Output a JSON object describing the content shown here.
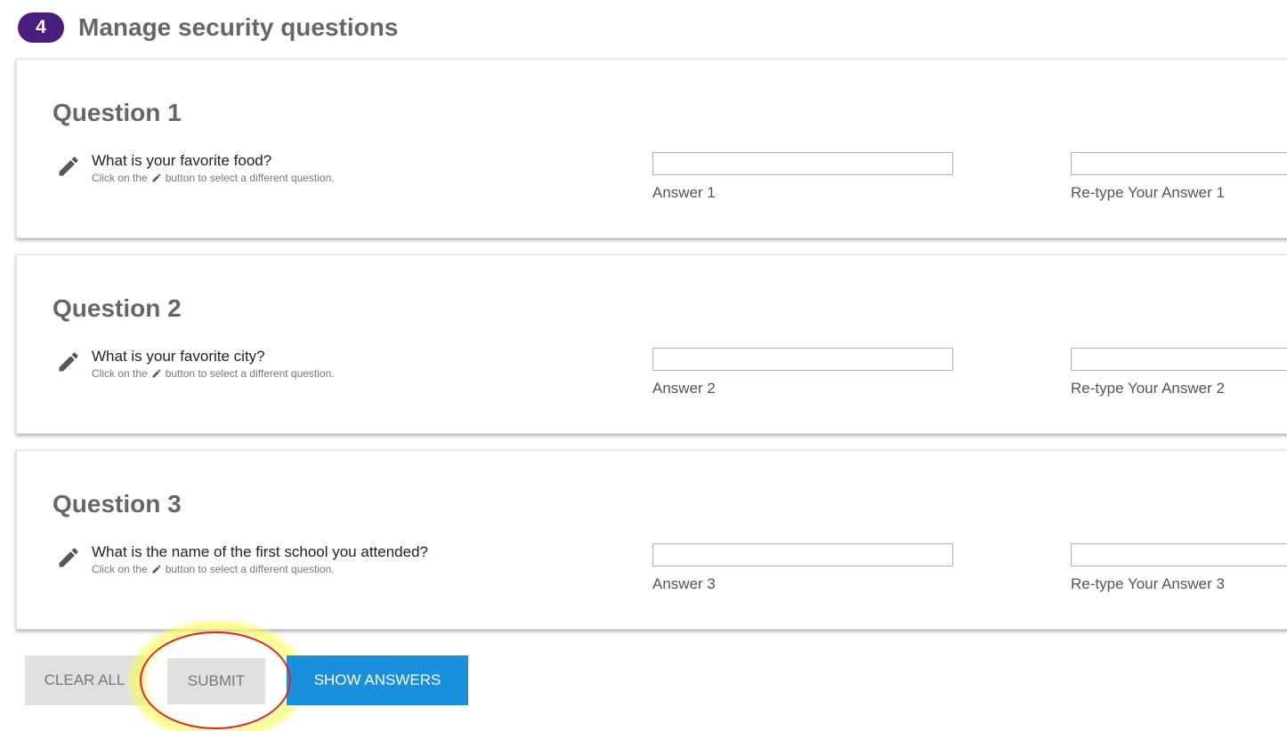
{
  "step": {
    "number": "4",
    "title": "Manage security questions"
  },
  "questions": [
    {
      "title": "Question 1",
      "question": "What is your favorite food?",
      "hint_before": "Click on the",
      "hint_after": "button to select a different question.",
      "answer_label": "Answer 1",
      "retype_label": "Re-type Your Answer 1",
      "answer_value": "",
      "retype_value": ""
    },
    {
      "title": "Question 2",
      "question": "What is your favorite city?",
      "hint_before": "Click on the",
      "hint_after": "button to select a different question.",
      "answer_label": "Answer 2",
      "retype_label": "Re-type Your Answer 2",
      "answer_value": "",
      "retype_value": ""
    },
    {
      "title": "Question 3",
      "question": "What is the name of the first school you attended?",
      "hint_before": "Click on the",
      "hint_after": "button to select a different question.",
      "answer_label": "Answer 3",
      "retype_label": "Re-type Your Answer 3",
      "answer_value": "",
      "retype_value": ""
    }
  ],
  "buttons": {
    "clear_all": "CLEAR ALL",
    "submit": "SUBMIT",
    "show_answers": "SHOW ANSWERS"
  },
  "icons": {
    "edit": "pencil-icon"
  },
  "colors": {
    "badge": "#4b1d7f",
    "primary_button": "#1a8fdc",
    "disabled_button": "#e0e0e0",
    "annotation_ring": "#e0242a",
    "annotation_glow": "#fafa5a"
  }
}
